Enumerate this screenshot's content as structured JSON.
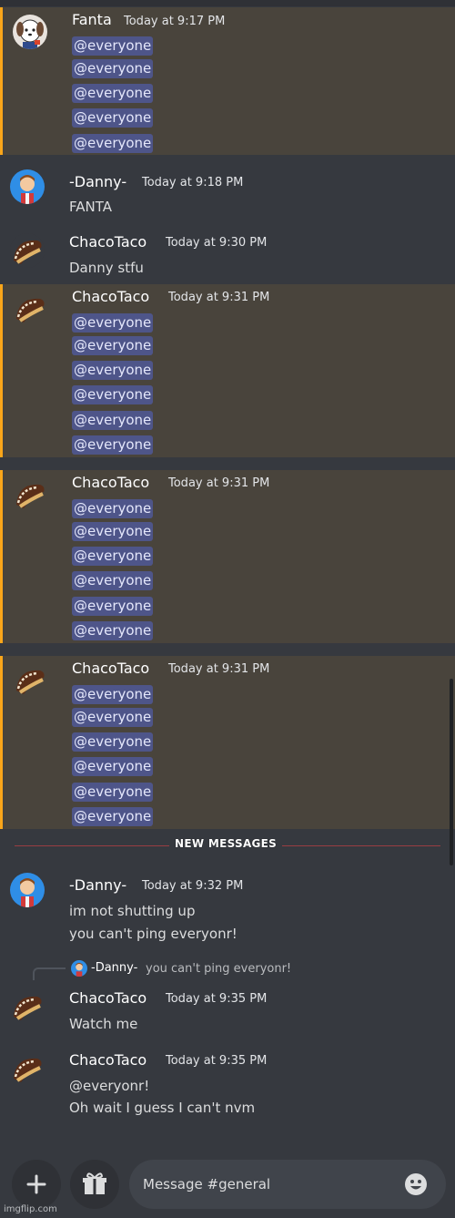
{
  "colors": {
    "background": "#36393f",
    "mention_highlight": "#49443c",
    "mention_bar": "#faa61a",
    "ping_pill": "#4e5589",
    "new_messages_line": "#ed4245"
  },
  "messages": [
    {
      "author": "Fanta",
      "time": "Today at 9:17 PM",
      "avatar": "dog-avatar",
      "lines": [
        "@everyone",
        "@everyone",
        "@everyone",
        "@everyone",
        "@everyone"
      ]
    },
    {
      "author": "-Danny-",
      "time": "Today at 9:18 PM",
      "avatar": "boy-avatar",
      "lines": [
        "FANTA"
      ]
    },
    {
      "author": "ChacoTaco",
      "time": "Today at 9:30 PM",
      "avatar": "taco-avatar",
      "lines": [
        "Danny stfu"
      ]
    },
    {
      "author": "ChacoTaco",
      "time": "Today at 9:31 PM",
      "avatar": "taco-avatar",
      "lines": [
        "@everyone",
        "@everyone",
        "@everyone",
        "@everyone",
        "@everyone",
        "@everyone"
      ]
    },
    {
      "author": "ChacoTaco",
      "time": "Today at 9:31 PM",
      "avatar": "taco-avatar",
      "lines": [
        "@everyone",
        "@everyone",
        "@everyone",
        "@everyone",
        "@everyone",
        "@everyone"
      ]
    },
    {
      "author": "ChacoTaco",
      "time": "Today at 9:31 PM",
      "avatar": "taco-avatar",
      "lines": [
        "@everyone",
        "@everyone",
        "@everyone",
        "@everyone",
        "@everyone",
        "@everyone"
      ]
    },
    {
      "author": "-Danny-",
      "time": "Today at 9:32 PM",
      "avatar": "boy-avatar",
      "lines": [
        "im not shutting up",
        "you can't ping everyonr!"
      ]
    },
    {
      "author": "ChacoTaco",
      "time": "Today at 9:35 PM",
      "avatar": "taco-avatar",
      "lines": [
        "Watch me"
      ],
      "reply": {
        "author": "-Danny-",
        "text": "you can't ping everyonr!"
      }
    },
    {
      "author": "ChacoTaco",
      "time": "Today at 9:35 PM",
      "avatar": "taco-avatar",
      "lines": [
        "@everyonr!",
        "Oh wait I guess I can't nvm"
      ]
    }
  ],
  "divider": {
    "label": "NEW MESSAGES"
  },
  "composer": {
    "placeholder": "Message #general",
    "plus_icon": "plus-icon",
    "gift_icon": "gift-icon",
    "emoji_icon": "emoji-icon"
  },
  "watermark": "imgflip.com"
}
